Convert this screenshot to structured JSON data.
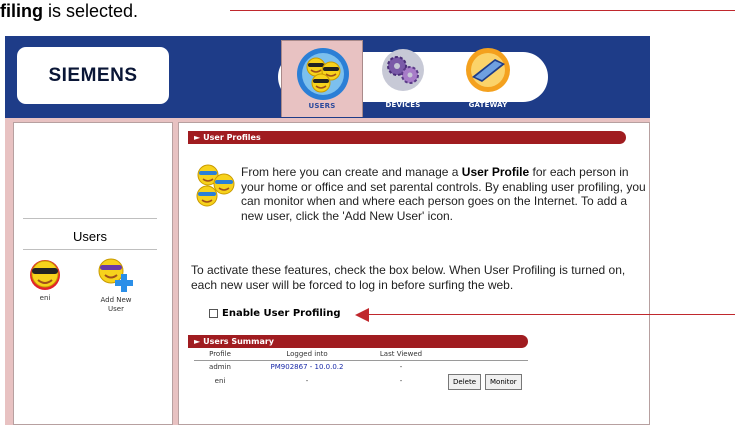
{
  "caption": {
    "prefix": "filing",
    "suffix": " is selected."
  },
  "logo": {
    "text": "SIEMENS"
  },
  "nav": {
    "tabs": [
      {
        "label": "USERS",
        "selected": true,
        "icon": "users-smiley-icon"
      },
      {
        "label": "DEVICES",
        "selected": false,
        "icon": "gears-icon"
      },
      {
        "label": "GATEWAY",
        "selected": false,
        "icon": "gateway-device-icon"
      }
    ]
  },
  "sidebar": {
    "heading": "Users",
    "users": [
      {
        "name": "eni",
        "icon": "smiley-sunglasses-icon"
      }
    ],
    "add_user_label": "Add New User"
  },
  "main": {
    "section_title": "User Profiles",
    "intro": {
      "part1": "From here you can create and manage a ",
      "bold": "User Profile",
      "part2": " for each person in your home or office and set parental controls. By enabling user profiling, you can monitor when and where each person goes on the Internet. To add a new user, click the 'Add New User' icon."
    },
    "activate_text": "To activate these features, check the box below. When User Profiling is turned on, each new user will be forced to log in before surfing the web.",
    "enable_label": "Enable User Profiling",
    "enable_checked": false,
    "summary": {
      "title": "Users Summary",
      "columns": [
        "Profile",
        "Logged into",
        "Last Viewed"
      ],
      "rows": [
        {
          "profile": "admin",
          "logged_into": "PM902867 - 10.0.0.2",
          "last_viewed": "-"
        },
        {
          "profile": "eni",
          "logged_into": "-",
          "last_viewed": "-"
        }
      ],
      "buttons": {
        "delete": "Delete",
        "monitor": "Monitor"
      }
    }
  },
  "colors": {
    "brand_blue": "#1e3c88",
    "accent_red": "#a01c20",
    "frame_pink": "#e8c2c2",
    "link_blue": "#1a2aa8"
  }
}
